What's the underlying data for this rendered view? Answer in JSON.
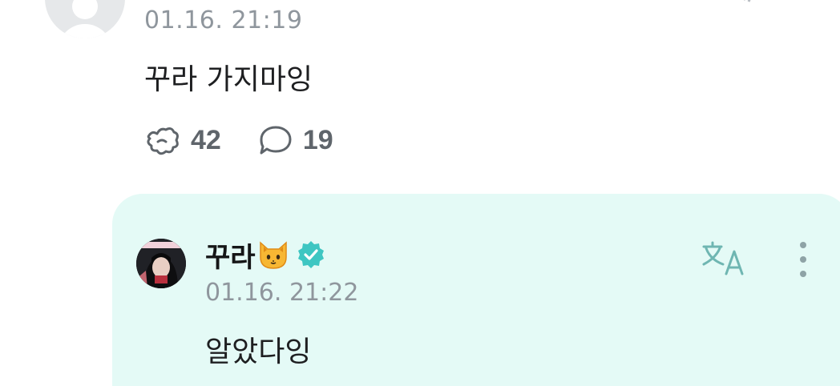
{
  "top_comment": {
    "timestamp": "01.16. 21:19",
    "message": "꾸라 가지마잉",
    "like_count": "42",
    "reply_count": "19"
  },
  "reply": {
    "author": "꾸라",
    "timestamp": "01.16. 21:22",
    "message": "알았다잉",
    "author_emoji": "cat-face-icon",
    "verified": true
  },
  "colors": {
    "reply_background": "#e4faf6",
    "verified_badge": "#3ec6c2",
    "timestamp": "#8f969d",
    "icon_gray": "#5f656b"
  }
}
